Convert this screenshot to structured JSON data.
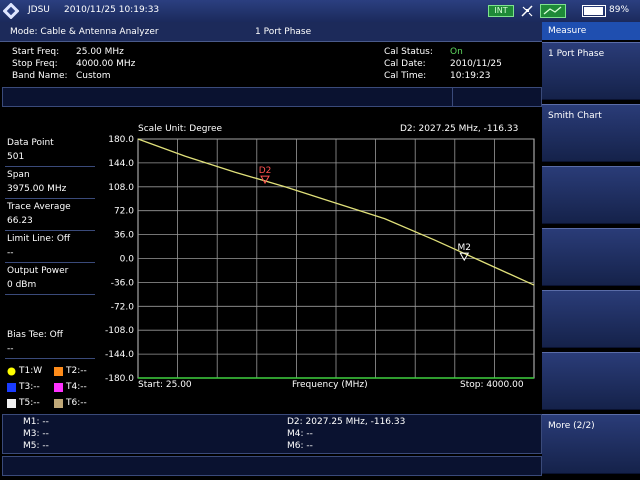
{
  "status": {
    "brand": "JDSU",
    "datetime": "2010/11/25 10:19:33",
    "int_badge": "INT",
    "battery": "89%"
  },
  "header": {
    "mode": "Mode: Cable & Antenna Analyzer",
    "measurement": "1 Port Phase"
  },
  "info": {
    "start_freq_label": "Start Freq:",
    "start_freq_value": "25.00 MHz",
    "stop_freq_label": "Stop Freq:",
    "stop_freq_value": "4000.00 MHz",
    "band_name_label": "Band Name:",
    "band_name_value": "Custom",
    "cal_status_label": "Cal Status:",
    "cal_status_value": "On",
    "cal_date_label": "Cal Date:",
    "cal_date_value": "2010/11/25",
    "cal_time_label": "Cal Time:",
    "cal_time_value": "10:19:23"
  },
  "left": {
    "data_point_label": "Data Point",
    "data_point_value": "501",
    "span_label": "Span",
    "span_value": "3975.00 MHz",
    "trace_avg_label": "Trace Average",
    "trace_avg_value": "66.23",
    "limit_line": "Limit Line: Off",
    "limit_line_value": "--",
    "output_power_label": "Output Power",
    "output_power_value": "0 dBm",
    "bias_tee": "Bias Tee: Off",
    "bias_tee_value": "--",
    "traces": [
      {
        "label": "T1:W",
        "color": "#ffff00",
        "shape": "circle"
      },
      {
        "label": "T2:--",
        "color": "#ff8c1a",
        "shape": "square"
      },
      {
        "label": "T3:--",
        "color": "#1a3cff",
        "shape": "square"
      },
      {
        "label": "T4:--",
        "color": "#ff33ff",
        "shape": "square"
      },
      {
        "label": "T5:--",
        "color": "#f0f0f0",
        "shape": "square"
      },
      {
        "label": "T6:--",
        "color": "#c0a878",
        "shape": "square"
      }
    ]
  },
  "graph": {
    "scale_unit": "Scale Unit: Degree",
    "d2_readout": "D2: 2027.25 MHz, -116.33",
    "x_start": "Start: 25.00",
    "x_label": "Frequency (MHz)",
    "x_stop": "Stop: 4000.00"
  },
  "chart_data": {
    "type": "line",
    "ylim": [
      -180,
      180
    ],
    "xlim": [
      25,
      4000
    ],
    "y_ticks": [
      "180.0",
      "144.0",
      "108.0",
      "72.0",
      "36.0",
      "0.0",
      "-36.0",
      "-72.0",
      "-108.0",
      "-144.0",
      "-180.0"
    ],
    "y_tick_values": [
      180,
      144,
      108,
      72,
      36,
      0,
      -36,
      -72,
      -108,
      -144,
      -180
    ],
    "grid": true,
    "series": [
      {
        "color": "#e0e07a",
        "x": [
          25,
          500,
          1000,
          1500,
          2000,
          2500,
          3000,
          3500,
          4000
        ],
        "y": [
          180,
          154,
          130,
          108,
          84,
          60,
          28,
          -6,
          -40
        ]
      }
    ],
    "markers": [
      {
        "label": "D2",
        "x": 1300,
        "y": 118,
        "color": "#ff5050"
      },
      {
        "label": "M2",
        "x": 3300,
        "y": 2,
        "color": "#ffffff"
      }
    ]
  },
  "markers_panel": {
    "m1": "M1: --",
    "m3": "M3: --",
    "m5": "M5: --",
    "d2": "D2: 2027.25 MHz, -116.33",
    "m4": "M4: --",
    "m6": "M6: --"
  },
  "softkeys": {
    "title": "Measure",
    "items": [
      {
        "label": "1 Port Phase"
      },
      {
        "label": "Smith Chart"
      },
      {
        "label": ""
      },
      {
        "label": ""
      },
      {
        "label": ""
      },
      {
        "label": ""
      },
      {
        "label": "More (2/2)"
      }
    ]
  }
}
